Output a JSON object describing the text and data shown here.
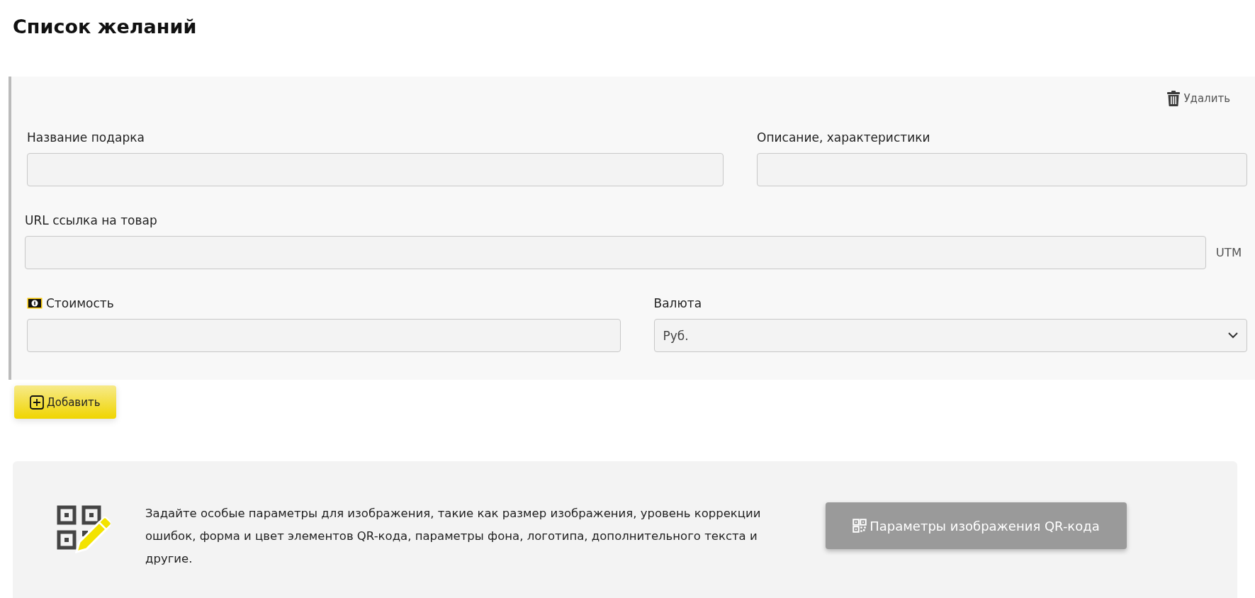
{
  "page_title": "Список желаний",
  "wish_item": {
    "delete_button": {
      "label": "Удалить"
    },
    "rows": [
      {
        "fields": [
          {
            "kind": "input",
            "label": "Название подарка"
          },
          {
            "kind": "input",
            "label": "Описание, характеристики"
          }
        ]
      },
      {
        "fields": [
          {
            "kind": "input",
            "label": "URL ссылка на товар",
            "suffix": "UTM"
          }
        ]
      },
      {
        "fields": [
          {
            "kind": "cost",
            "label": "Стоимость"
          },
          {
            "kind": "select",
            "label": "Валюта",
            "value": "Руб."
          }
        ]
      }
    ]
  },
  "add_button": {
    "label": "Добавить"
  },
  "qr_panel": {
    "text": "Задайте особые параметры для изображения, такие как размер изображения, уровень коррекции ошибок, форма и цвет элементов QR-кода, параметры фона, логотипа, дополнительного текста и другие.",
    "button": {
      "label": "Параметры изображения QR-кода"
    }
  }
}
